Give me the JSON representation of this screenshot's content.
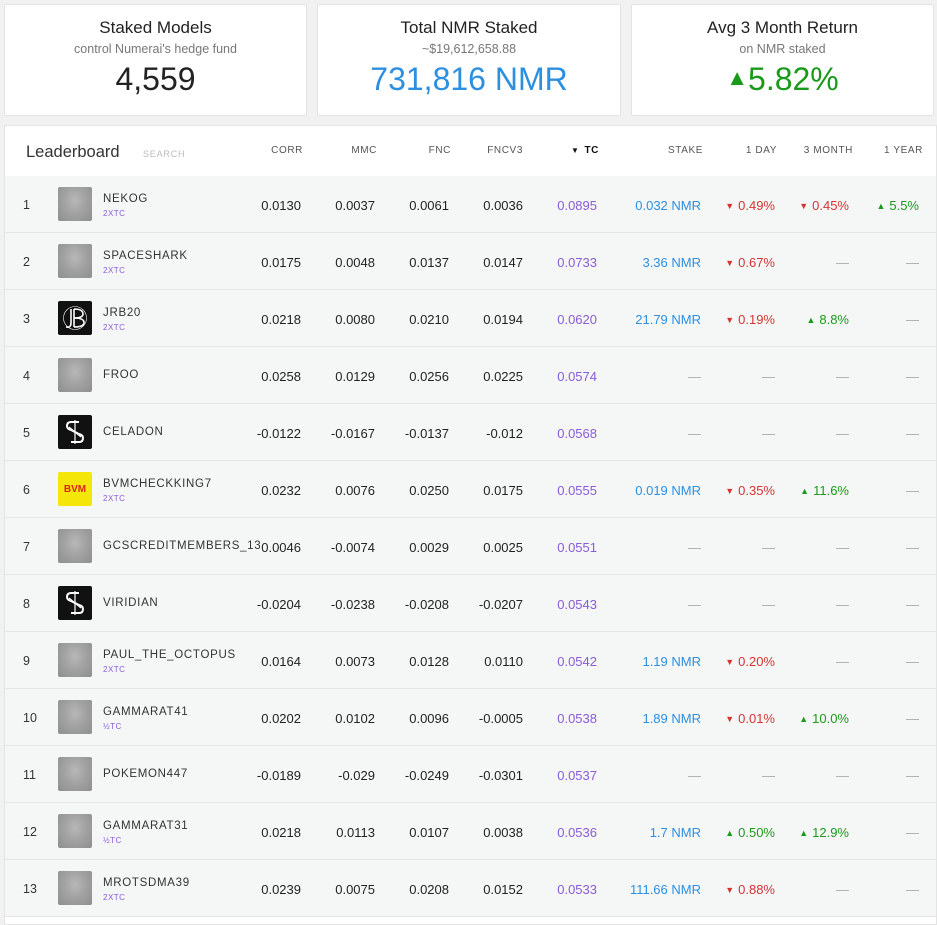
{
  "cards": {
    "staked_models": {
      "title": "Staked Models",
      "sub": "control Numerai's hedge fund",
      "value": "4,559"
    },
    "total_nmr": {
      "title": "Total NMR Staked",
      "sub": "~$19,612,658.88",
      "value": "731,816 NMR"
    },
    "avg_return": {
      "title": "Avg 3 Month Return",
      "sub": "on NMR staked",
      "arrow": "▲",
      "value": "5.82%"
    }
  },
  "leaderboard": {
    "title": "Leaderboard",
    "search_placeholder": "SEARCH",
    "columns": {
      "corr": "CORR",
      "mmc": "MMC",
      "fnc": "FNC",
      "fncv3": "FNCV3",
      "tc": "TC",
      "tc_sort_icon": "▼",
      "stake": "STAKE",
      "day1": "1 DAY",
      "month3": "3 MONTH",
      "year1": "1 YEAR"
    },
    "rows": [
      {
        "rank": "1",
        "name": "NEKOG",
        "badge": "2XTC",
        "avatar": "blurred-avatar",
        "corr": "0.0130",
        "mmc": "0.0037",
        "fnc": "0.0061",
        "fncv3": "0.0036",
        "tc": "0.0895",
        "stake": "0.032 NMR",
        "day1": "0.49%",
        "day1_dir": "down",
        "month3": "0.45%",
        "month3_dir": "down",
        "year1": "5.5%",
        "year1_dir": "up"
      },
      {
        "rank": "2",
        "name": "SPACESHARK",
        "badge": "2XTC",
        "avatar": "blurred-avatar",
        "corr": "0.0175",
        "mmc": "0.0048",
        "fnc": "0.0137",
        "fncv3": "0.0147",
        "tc": "0.0733",
        "stake": "3.36 NMR",
        "day1": "0.67%",
        "day1_dir": "down",
        "month3": "—",
        "month3_dir": "none",
        "year1": "—",
        "year1_dir": "none"
      },
      {
        "rank": "3",
        "name": "JRB20",
        "badge": "2XTC",
        "avatar": "jrb-logo",
        "corr": "0.0218",
        "mmc": "0.0080",
        "fnc": "0.0210",
        "fncv3": "0.0194",
        "tc": "0.0620",
        "stake": "21.79 NMR",
        "day1": "0.19%",
        "day1_dir": "down",
        "month3": "8.8%",
        "month3_dir": "up",
        "year1": "—",
        "year1_dir": "none"
      },
      {
        "rank": "4",
        "name": "FROO",
        "badge": "",
        "avatar": "blurred-avatar",
        "corr": "0.0258",
        "mmc": "0.0129",
        "fnc": "0.0256",
        "fncv3": "0.0225",
        "tc": "0.0574",
        "stake": "—",
        "day1": "—",
        "day1_dir": "none",
        "month3": "—",
        "month3_dir": "none",
        "year1": "—",
        "year1_dir": "none"
      },
      {
        "rank": "5",
        "name": "CELADON",
        "badge": "",
        "avatar": "numerai-logo",
        "corr": "-0.0122",
        "mmc": "-0.0167",
        "fnc": "-0.0137",
        "fncv3": "-0.012",
        "tc": "0.0568",
        "stake": "—",
        "day1": "—",
        "day1_dir": "none",
        "month3": "—",
        "month3_dir": "none",
        "year1": "—",
        "year1_dir": "none"
      },
      {
        "rank": "6",
        "name": "BVMCHECKKING7",
        "badge": "2XTC",
        "avatar": "bvm-logo",
        "avatar_text": "BVM",
        "corr": "0.0232",
        "mmc": "0.0076",
        "fnc": "0.0250",
        "fncv3": "0.0175",
        "tc": "0.0555",
        "stake": "0.019 NMR",
        "day1": "0.35%",
        "day1_dir": "down",
        "month3": "11.6%",
        "month3_dir": "up",
        "year1": "—",
        "year1_dir": "none"
      },
      {
        "rank": "7",
        "name": "GCSCREDITMEMBERS_13",
        "badge": "",
        "avatar": "blurred-avatar",
        "corr": "0.0046",
        "mmc": "-0.0074",
        "fnc": "0.0029",
        "fncv3": "0.0025",
        "tc": "0.0551",
        "stake": "—",
        "day1": "—",
        "day1_dir": "none",
        "month3": "—",
        "month3_dir": "none",
        "year1": "—",
        "year1_dir": "none"
      },
      {
        "rank": "8",
        "name": "VIRIDIAN",
        "badge": "",
        "avatar": "numerai-logo",
        "corr": "-0.0204",
        "mmc": "-0.0238",
        "fnc": "-0.0208",
        "fncv3": "-0.0207",
        "tc": "0.0543",
        "stake": "—",
        "day1": "—",
        "day1_dir": "none",
        "month3": "—",
        "month3_dir": "none",
        "year1": "—",
        "year1_dir": "none"
      },
      {
        "rank": "9",
        "name": "PAUL_THE_OCTOPUS",
        "badge": "2XTC",
        "avatar": "blurred-avatar",
        "corr": "0.0164",
        "mmc": "0.0073",
        "fnc": "0.0128",
        "fncv3": "0.0110",
        "tc": "0.0542",
        "stake": "1.19 NMR",
        "day1": "0.20%",
        "day1_dir": "down",
        "month3": "—",
        "month3_dir": "none",
        "year1": "—",
        "year1_dir": "none"
      },
      {
        "rank": "10",
        "name": "GAMMARAT41",
        "badge": "½TC",
        "avatar": "blurred-avatar",
        "corr": "0.0202",
        "mmc": "0.0102",
        "fnc": "0.0096",
        "fncv3": "-0.0005",
        "tc": "0.0538",
        "stake": "1.89 NMR",
        "day1": "0.01%",
        "day1_dir": "down",
        "month3": "10.0%",
        "month3_dir": "up",
        "year1": "—",
        "year1_dir": "none"
      },
      {
        "rank": "11",
        "name": "POKEMON447",
        "badge": "",
        "avatar": "blurred-avatar",
        "corr": "-0.0189",
        "mmc": "-0.029",
        "fnc": "-0.0249",
        "fncv3": "-0.0301",
        "tc": "0.0537",
        "stake": "—",
        "day1": "—",
        "day1_dir": "none",
        "month3": "—",
        "month3_dir": "none",
        "year1": "—",
        "year1_dir": "none"
      },
      {
        "rank": "12",
        "name": "GAMMARAT31",
        "badge": "½TC",
        "avatar": "blurred-avatar",
        "corr": "0.0218",
        "mmc": "0.0113",
        "fnc": "0.0107",
        "fncv3": "0.0038",
        "tc": "0.0536",
        "stake": "1.7 NMR",
        "day1": "0.50%",
        "day1_dir": "up",
        "month3": "12.9%",
        "month3_dir": "up",
        "year1": "—",
        "year1_dir": "none"
      },
      {
        "rank": "13",
        "name": "MROTSDMA39",
        "badge": "2XTC",
        "avatar": "blurred-avatar",
        "corr": "0.0239",
        "mmc": "0.0075",
        "fnc": "0.0208",
        "fncv3": "0.0152",
        "tc": "0.0533",
        "stake": "111.66 NMR",
        "day1": "0.88%",
        "day1_dir": "down",
        "month3": "—",
        "month3_dir": "none",
        "year1": "—",
        "year1_dir": "none"
      }
    ]
  },
  "colors": {
    "stake_blue": "#2d8fe0",
    "tc_purple": "#8a5bd6",
    "up_green": "#1a9a1a",
    "down_red": "#d63333"
  }
}
